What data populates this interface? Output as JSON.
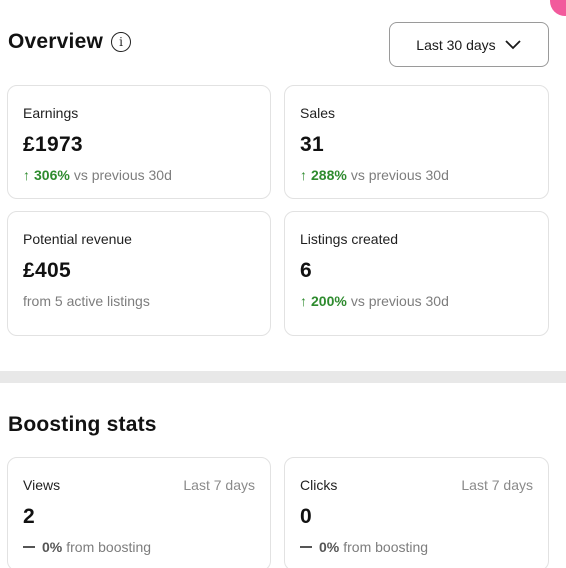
{
  "overview": {
    "title": "Overview",
    "info_icon": "i",
    "range_label": "Last 30 days",
    "cards": [
      {
        "label": "Earnings",
        "value": "£1973",
        "pct": "306%",
        "note": "vs previous 30d"
      },
      {
        "label": "Sales",
        "value": "31",
        "pct": "288%",
        "note": "vs previous 30d"
      },
      {
        "label": "Potential revenue",
        "value": "£405",
        "note": "from 5 active listings"
      },
      {
        "label": "Listings created",
        "value": "6",
        "pct": "200%",
        "note": "vs previous 30d"
      }
    ]
  },
  "boosting": {
    "title": "Boosting stats",
    "cards": [
      {
        "label": "Views",
        "period": "Last 7 days",
        "value": "2",
        "pct": "0%",
        "note": "from boosting"
      },
      {
        "label": "Clicks",
        "period": "Last 7 days",
        "value": "0",
        "pct": "0%",
        "note": "from boosting"
      }
    ]
  },
  "colors": {
    "positive": "#2e8b2e",
    "accent": "#f25a9c",
    "card_border": "#e2e2e2"
  },
  "icons": {
    "info": "info-icon",
    "chevron": "chevron-down-icon",
    "up_arrow": "arrow-up-icon",
    "dash": "dash-icon"
  }
}
